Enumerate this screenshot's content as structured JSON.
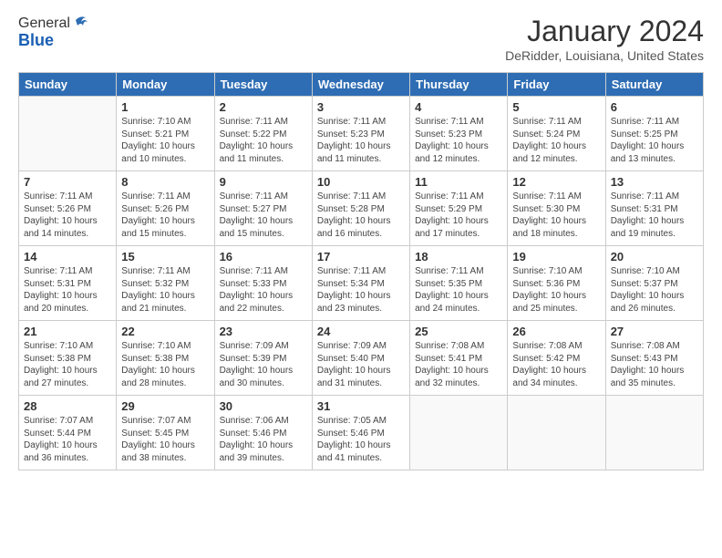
{
  "logo": {
    "general": "General",
    "blue": "Blue"
  },
  "header": {
    "month": "January 2024",
    "location": "DeRidder, Louisiana, United States"
  },
  "days_of_week": [
    "Sunday",
    "Monday",
    "Tuesday",
    "Wednesday",
    "Thursday",
    "Friday",
    "Saturday"
  ],
  "weeks": [
    [
      {
        "num": "",
        "sunrise": "",
        "sunset": "",
        "daylight": ""
      },
      {
        "num": "1",
        "sunrise": "Sunrise: 7:10 AM",
        "sunset": "Sunset: 5:21 PM",
        "daylight": "Daylight: 10 hours and 10 minutes."
      },
      {
        "num": "2",
        "sunrise": "Sunrise: 7:11 AM",
        "sunset": "Sunset: 5:22 PM",
        "daylight": "Daylight: 10 hours and 11 minutes."
      },
      {
        "num": "3",
        "sunrise": "Sunrise: 7:11 AM",
        "sunset": "Sunset: 5:23 PM",
        "daylight": "Daylight: 10 hours and 11 minutes."
      },
      {
        "num": "4",
        "sunrise": "Sunrise: 7:11 AM",
        "sunset": "Sunset: 5:23 PM",
        "daylight": "Daylight: 10 hours and 12 minutes."
      },
      {
        "num": "5",
        "sunrise": "Sunrise: 7:11 AM",
        "sunset": "Sunset: 5:24 PM",
        "daylight": "Daylight: 10 hours and 12 minutes."
      },
      {
        "num": "6",
        "sunrise": "Sunrise: 7:11 AM",
        "sunset": "Sunset: 5:25 PM",
        "daylight": "Daylight: 10 hours and 13 minutes."
      }
    ],
    [
      {
        "num": "7",
        "sunrise": "Sunrise: 7:11 AM",
        "sunset": "Sunset: 5:26 PM",
        "daylight": "Daylight: 10 hours and 14 minutes."
      },
      {
        "num": "8",
        "sunrise": "Sunrise: 7:11 AM",
        "sunset": "Sunset: 5:26 PM",
        "daylight": "Daylight: 10 hours and 15 minutes."
      },
      {
        "num": "9",
        "sunrise": "Sunrise: 7:11 AM",
        "sunset": "Sunset: 5:27 PM",
        "daylight": "Daylight: 10 hours and 15 minutes."
      },
      {
        "num": "10",
        "sunrise": "Sunrise: 7:11 AM",
        "sunset": "Sunset: 5:28 PM",
        "daylight": "Daylight: 10 hours and 16 minutes."
      },
      {
        "num": "11",
        "sunrise": "Sunrise: 7:11 AM",
        "sunset": "Sunset: 5:29 PM",
        "daylight": "Daylight: 10 hours and 17 minutes."
      },
      {
        "num": "12",
        "sunrise": "Sunrise: 7:11 AM",
        "sunset": "Sunset: 5:30 PM",
        "daylight": "Daylight: 10 hours and 18 minutes."
      },
      {
        "num": "13",
        "sunrise": "Sunrise: 7:11 AM",
        "sunset": "Sunset: 5:31 PM",
        "daylight": "Daylight: 10 hours and 19 minutes."
      }
    ],
    [
      {
        "num": "14",
        "sunrise": "Sunrise: 7:11 AM",
        "sunset": "Sunset: 5:31 PM",
        "daylight": "Daylight: 10 hours and 20 minutes."
      },
      {
        "num": "15",
        "sunrise": "Sunrise: 7:11 AM",
        "sunset": "Sunset: 5:32 PM",
        "daylight": "Daylight: 10 hours and 21 minutes."
      },
      {
        "num": "16",
        "sunrise": "Sunrise: 7:11 AM",
        "sunset": "Sunset: 5:33 PM",
        "daylight": "Daylight: 10 hours and 22 minutes."
      },
      {
        "num": "17",
        "sunrise": "Sunrise: 7:11 AM",
        "sunset": "Sunset: 5:34 PM",
        "daylight": "Daylight: 10 hours and 23 minutes."
      },
      {
        "num": "18",
        "sunrise": "Sunrise: 7:11 AM",
        "sunset": "Sunset: 5:35 PM",
        "daylight": "Daylight: 10 hours and 24 minutes."
      },
      {
        "num": "19",
        "sunrise": "Sunrise: 7:10 AM",
        "sunset": "Sunset: 5:36 PM",
        "daylight": "Daylight: 10 hours and 25 minutes."
      },
      {
        "num": "20",
        "sunrise": "Sunrise: 7:10 AM",
        "sunset": "Sunset: 5:37 PM",
        "daylight": "Daylight: 10 hours and 26 minutes."
      }
    ],
    [
      {
        "num": "21",
        "sunrise": "Sunrise: 7:10 AM",
        "sunset": "Sunset: 5:38 PM",
        "daylight": "Daylight: 10 hours and 27 minutes."
      },
      {
        "num": "22",
        "sunrise": "Sunrise: 7:10 AM",
        "sunset": "Sunset: 5:38 PM",
        "daylight": "Daylight: 10 hours and 28 minutes."
      },
      {
        "num": "23",
        "sunrise": "Sunrise: 7:09 AM",
        "sunset": "Sunset: 5:39 PM",
        "daylight": "Daylight: 10 hours and 30 minutes."
      },
      {
        "num": "24",
        "sunrise": "Sunrise: 7:09 AM",
        "sunset": "Sunset: 5:40 PM",
        "daylight": "Daylight: 10 hours and 31 minutes."
      },
      {
        "num": "25",
        "sunrise": "Sunrise: 7:08 AM",
        "sunset": "Sunset: 5:41 PM",
        "daylight": "Daylight: 10 hours and 32 minutes."
      },
      {
        "num": "26",
        "sunrise": "Sunrise: 7:08 AM",
        "sunset": "Sunset: 5:42 PM",
        "daylight": "Daylight: 10 hours and 34 minutes."
      },
      {
        "num": "27",
        "sunrise": "Sunrise: 7:08 AM",
        "sunset": "Sunset: 5:43 PM",
        "daylight": "Daylight: 10 hours and 35 minutes."
      }
    ],
    [
      {
        "num": "28",
        "sunrise": "Sunrise: 7:07 AM",
        "sunset": "Sunset: 5:44 PM",
        "daylight": "Daylight: 10 hours and 36 minutes."
      },
      {
        "num": "29",
        "sunrise": "Sunrise: 7:07 AM",
        "sunset": "Sunset: 5:45 PM",
        "daylight": "Daylight: 10 hours and 38 minutes."
      },
      {
        "num": "30",
        "sunrise": "Sunrise: 7:06 AM",
        "sunset": "Sunset: 5:46 PM",
        "daylight": "Daylight: 10 hours and 39 minutes."
      },
      {
        "num": "31",
        "sunrise": "Sunrise: 7:05 AM",
        "sunset": "Sunset: 5:46 PM",
        "daylight": "Daylight: 10 hours and 41 minutes."
      },
      {
        "num": "",
        "sunrise": "",
        "sunset": "",
        "daylight": ""
      },
      {
        "num": "",
        "sunrise": "",
        "sunset": "",
        "daylight": ""
      },
      {
        "num": "",
        "sunrise": "",
        "sunset": "",
        "daylight": ""
      }
    ]
  ]
}
